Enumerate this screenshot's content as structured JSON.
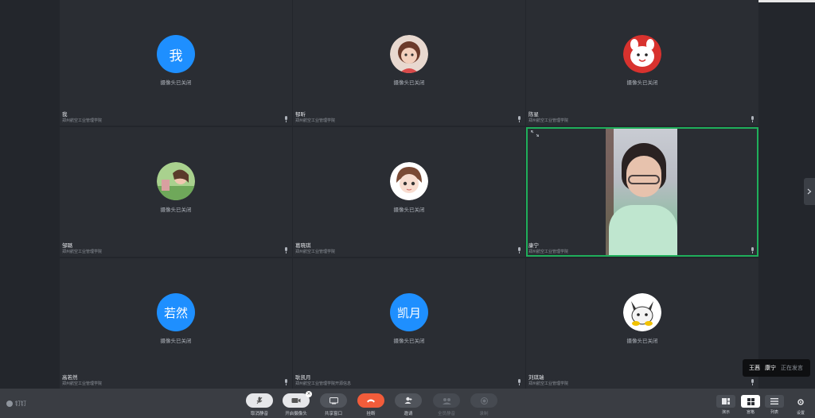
{
  "window": {
    "colors": {
      "accent_blue": "#1e8fff",
      "active_green": "#1fae5b",
      "hangup_red": "#f25c3a"
    }
  },
  "participants": [
    {
      "name": "我",
      "org": "郑州航空工业管理学院",
      "avatar_text": "我",
      "avatar_kind": "text",
      "status": "摄像头已关闭"
    },
    {
      "name": "郁昕",
      "org": "郑州航空工业管理学院",
      "avatar_kind": "image",
      "avatar_icon": "girl-cartoon-avatar-icon",
      "status": "摄像头已关闭"
    },
    {
      "name": "陈星",
      "org": "郑州航空工业管理学院",
      "avatar_kind": "image",
      "avatar_icon": "white-cartoon-avatar-icon",
      "status": "摄像头已关闭"
    },
    {
      "name": "邹璐",
      "org": "郑州航空工业管理学院",
      "avatar_kind": "image",
      "avatar_icon": "green-scene-avatar-icon",
      "status": "摄像头已关闭"
    },
    {
      "name": "葛晓琪",
      "org": "郑州航空工业管理学院",
      "avatar_kind": "image",
      "avatar_icon": "chibi-girl-avatar-icon",
      "status": "摄像头已关闭"
    },
    {
      "name": "康宁",
      "org": "郑州航空工业管理学院",
      "avatar_kind": "video",
      "status": ""
    },
    {
      "name": "高若然",
      "org": "郑州航空工业管理学院",
      "avatar_text": "若然",
      "avatar_kind": "text",
      "status": "摄像头已关闭"
    },
    {
      "name": "耿凯月",
      "org": "郑州航空工业管理学院开源信息",
      "avatar_text": "凯月",
      "avatar_kind": "text",
      "status": "摄像头已关闭"
    },
    {
      "name": "刘琪瑞",
      "org": "郑州航空工业管理学院",
      "avatar_kind": "image",
      "avatar_icon": "fox-cartoon-avatar-icon",
      "status": "摄像头已关闭"
    }
  ],
  "speaking": {
    "name1": "王茜",
    "name2": "康宁",
    "status": "正在发言"
  },
  "toolbar": {
    "brand": "钉钉",
    "buttons": [
      {
        "label": "取消静音",
        "icon": "mic-icon"
      },
      {
        "label": "开启摄像头",
        "icon": "camera-icon"
      },
      {
        "label": "共享窗口",
        "icon": "screen-share-icon"
      },
      {
        "label": "挂断",
        "icon": "hangup-icon"
      },
      {
        "label": "邀请",
        "icon": "invite-icon"
      },
      {
        "label": "全员静音",
        "icon": "mute-all-icon"
      },
      {
        "label": "录制",
        "icon": "record-icon"
      }
    ],
    "views": [
      {
        "label": "演示",
        "icon": "presentation-view-icon"
      },
      {
        "label": "宫格",
        "icon": "grid-view-icon"
      },
      {
        "label": "列表",
        "icon": "list-view-icon"
      }
    ],
    "settings_label": "设置"
  }
}
